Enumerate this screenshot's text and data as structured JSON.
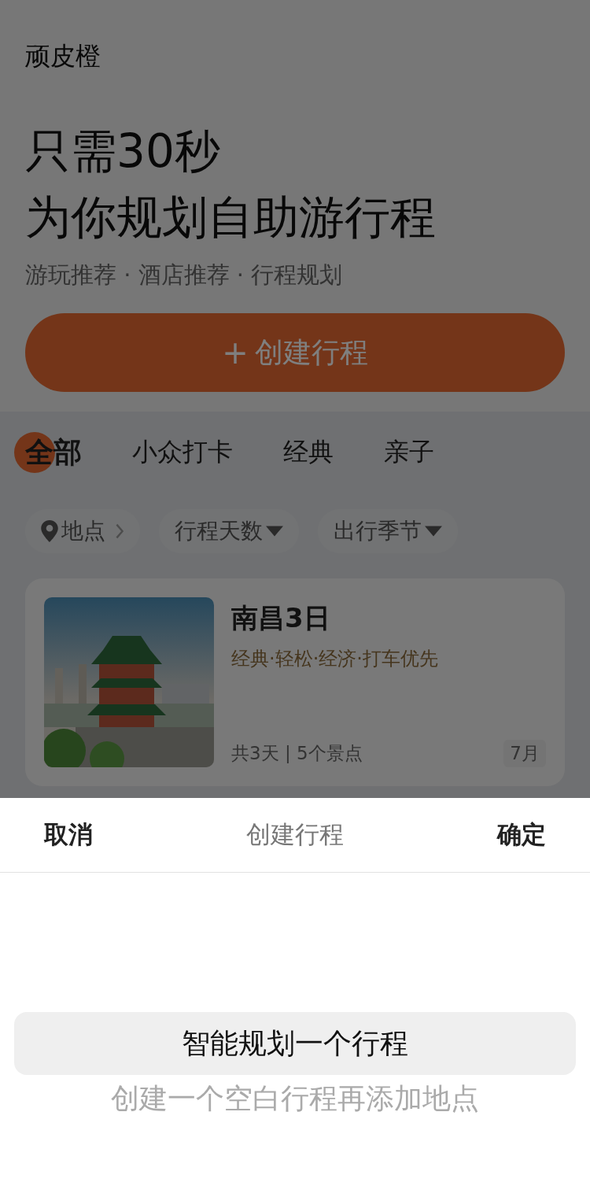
{
  "app_name": "顽皮橙",
  "headline": [
    "只需30秒",
    "为你规划自助游行程"
  ],
  "subtitle": "游玩推荐 · 酒店推荐 · 行程规划",
  "create_button": {
    "icon": "+",
    "label": "创建行程"
  },
  "tabs": [
    {
      "label": "全部",
      "selected": true
    },
    {
      "label": "小众打卡",
      "selected": false
    },
    {
      "label": "经典",
      "selected": false
    },
    {
      "label": "亲子",
      "selected": false
    }
  ],
  "filters": [
    {
      "kind": "location",
      "label": "地点"
    },
    {
      "kind": "dropdown",
      "label": "行程天数"
    },
    {
      "kind": "dropdown",
      "label": "出行季节"
    }
  ],
  "trips": [
    {
      "title": "南昌3日",
      "tags": "经典·轻松·经济·打车优先",
      "summary": "共3天 | 5个景点",
      "month": "7月"
    }
  ],
  "sheet": {
    "cancel": "取消",
    "title": "创建行程",
    "confirm": "确定",
    "options": [
      {
        "kind": "primary",
        "label": "智能规划一个行程"
      },
      {
        "kind": "secondary",
        "label": "创建一个空白行程再添加地点"
      }
    ]
  }
}
